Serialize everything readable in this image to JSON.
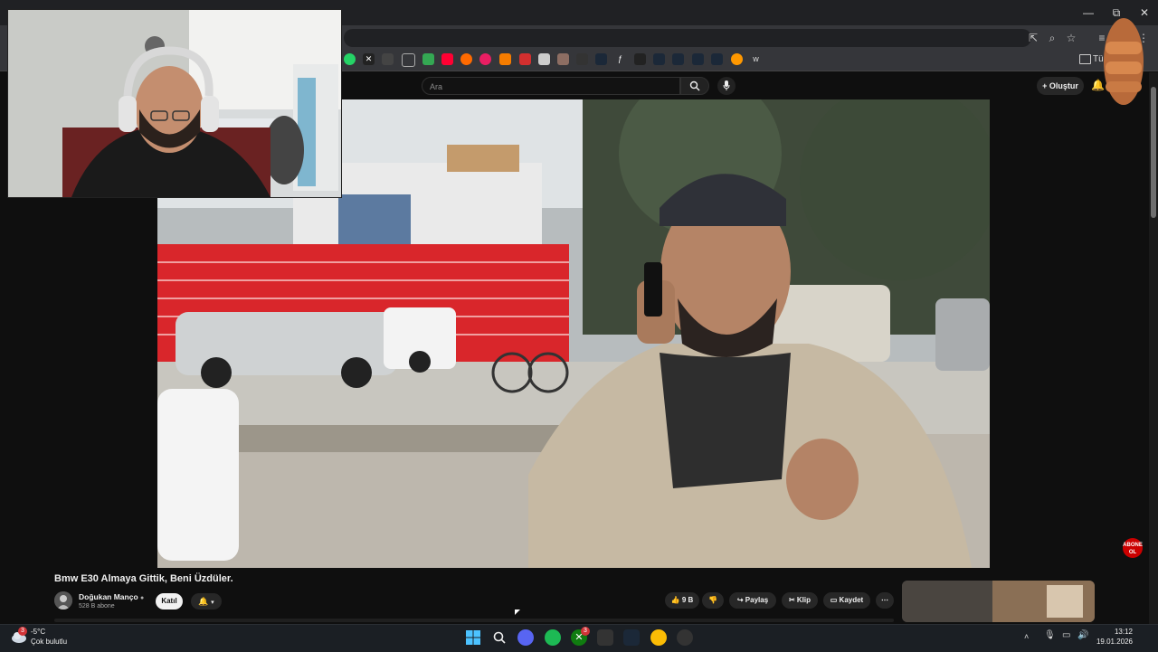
{
  "browser": {
    "window_controls": [
      "—",
      "⧉",
      "✕"
    ],
    "bookmarks_folder": "Tü"
  },
  "youtube": {
    "search_placeholder": "Ara",
    "create_label": "Oluştur"
  },
  "video": {
    "title": "Bmw E30 Almaya Gittik, Beni Üzdüler.",
    "channel": "Doğukan Manço",
    "subscribers": "528 B abone",
    "join_label": "Katıl",
    "likes": "9 B",
    "share_label": "Paylaş",
    "clip_label": "Klip",
    "save_label": "Kaydet",
    "subscribe_badge": "ABONE OL"
  },
  "taskbar": {
    "weather_temp": "-5°C",
    "weather_desc": "Çok bulutlu",
    "weather_badge": "3",
    "xbox_badge": "3",
    "time": "13:12",
    "date": "19.01.2026"
  },
  "colors": {
    "bg": "#0f0f0f",
    "accent_red": "#cc0000",
    "storefront_red": "#d9262b"
  }
}
